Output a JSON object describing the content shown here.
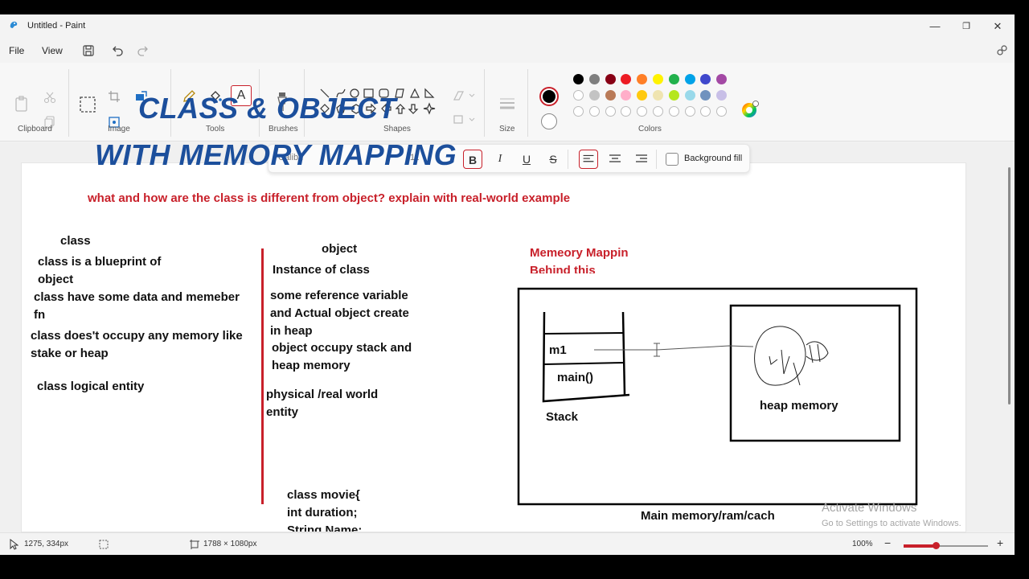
{
  "window": {
    "title": "Untitled - Paint",
    "minimize": "—",
    "maximize": "❐",
    "close": "✕"
  },
  "menu": {
    "file": "File",
    "view": "View"
  },
  "ribbon": {
    "groups": {
      "clipboard": "Clipboard",
      "image": "Image",
      "tools": "Tools",
      "brushes": "Brushes",
      "shapes": "Shapes",
      "size": "Size",
      "colors": "Colors"
    },
    "text_tool_glyph": "A",
    "palette_row1": [
      "#000000",
      "#7f7f7f",
      "#880015",
      "#ed1c24",
      "#ff7f27",
      "#fff200",
      "#22b14c",
      "#00a2e8",
      "#3f48cc",
      "#a349a4"
    ],
    "palette_row2": [
      "#ffffff",
      "#c3c3c3",
      "#b97a57",
      "#ffaec9",
      "#ffc90e",
      "#efe4b0",
      "#b5e61d",
      "#99d9ea",
      "#7092be",
      "#c8bfe7"
    ],
    "primary_color": "#000000",
    "secondary_color": "#ffffff"
  },
  "text_toolbar": {
    "font": "Calibri",
    "size": "11",
    "bold": "B",
    "italic": "I",
    "underline": "U",
    "strike": "S",
    "background_fill": "Background fill"
  },
  "canvas": {
    "title_line1": "CLASS &  OBJECT",
    "title_line2": "WITH MEMORY MAPPING",
    "question": "what  and how are the class is different from object? explain with real-world example",
    "class_col": {
      "heading": "class",
      "lines": [
        "class is a blueprint of",
        "object",
        "class have some data and  memeber",
        "fn",
        "class does't occupy any  memory like",
        "stake or heap",
        "class logical entity"
      ]
    },
    "object_col": {
      "heading": "object",
      "lines": [
        "Instance of class",
        "some reference variable",
        "and Actual object create",
        "in heap",
        "object occupy  stack and",
        "heap memory",
        "physical /real world",
        "entity"
      ]
    },
    "code_lines": [
      "class movie{",
      "int duration;",
      "String Name:"
    ],
    "memory": {
      "title1": "Memeory Mappin",
      "title2": "Behind this",
      "m1": "m1",
      "main": "main()",
      "stack": "Stack",
      "heap": "heap memory",
      "main_memory": "Main memory/ram/cach"
    }
  },
  "status": {
    "cursor_pos": "1275, 334px",
    "canvas_size": "1788 × 1080px",
    "zoom": "100%"
  },
  "watermark": {
    "line1": "Activate Windows",
    "line2": "Go to Settings to activate Windows."
  }
}
